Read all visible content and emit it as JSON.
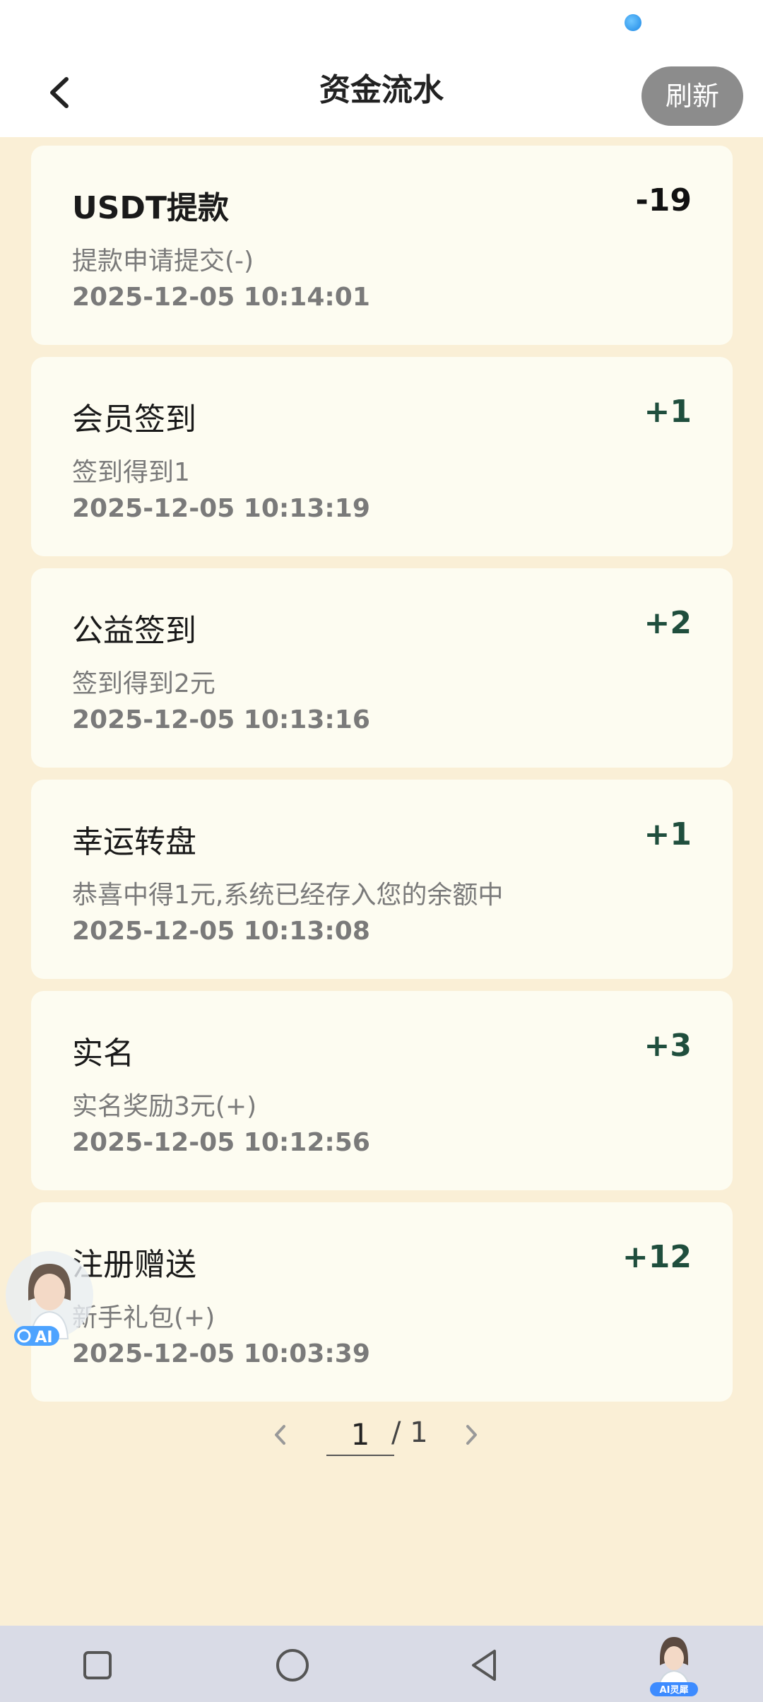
{
  "header": {
    "title": "资金流水",
    "refresh_label": "刷新"
  },
  "records": [
    {
      "title": "USDT提款",
      "amount": "-19",
      "desc": "提款申请提交(-)",
      "time": "2025-12-05 10:14:01"
    },
    {
      "title": "会员签到",
      "amount": "+1",
      "desc": "签到得到1",
      "time": "2025-12-05 10:13:19"
    },
    {
      "title": "公益签到",
      "amount": "+2",
      "desc": "签到得到2元",
      "time": "2025-12-05 10:13:16"
    },
    {
      "title": "幸运转盘",
      "amount": "+1",
      "desc": "恭喜中得1元,系统已经存入您的余额中",
      "time": "2025-12-05 10:13:08"
    },
    {
      "title": "实名",
      "amount": "+3",
      "desc": "实名奖励3元(+)",
      "time": "2025-12-05 10:12:56"
    },
    {
      "title": "注册赠送",
      "amount": "+12",
      "desc": "新手礼包(+)",
      "time": "2025-12-05 10:03:39"
    }
  ],
  "pagination": {
    "current": "1",
    "total": "/ 1"
  },
  "ai_assistant": {
    "badge": "AI",
    "nav_label": "AI灵犀"
  },
  "colors": {
    "background": "#faefd6",
    "card": "#fdfcf1",
    "positive_amount": "#1f4e3d",
    "refresh_button": "#8c8c8c"
  }
}
